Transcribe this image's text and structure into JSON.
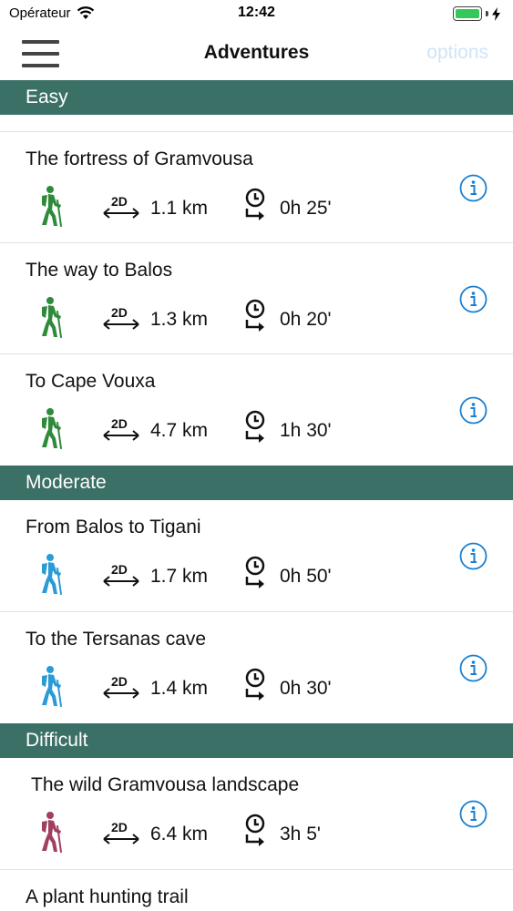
{
  "status": {
    "carrier": "Opérateur",
    "time": "12:42"
  },
  "nav": {
    "title": "Adventures",
    "options_label": "options"
  },
  "sections": [
    {
      "title": "Easy",
      "color": "#2e8b3a",
      "items": [
        {
          "title": "The fortress of Gramvousa",
          "distance": "1.1 km",
          "duration": "0h 25'"
        },
        {
          "title": "The way to Balos",
          "distance": "1.3 km",
          "duration": "0h 20'"
        },
        {
          "title": "To Cape Vouxa",
          "distance": "4.7 km",
          "duration": "1h 30'"
        }
      ]
    },
    {
      "title": "Moderate",
      "color": "#2a9bd6",
      "items": [
        {
          "title": "From Balos to Tigani",
          "distance": "1.7 km",
          "duration": "0h 50'"
        },
        {
          "title": "To the Tersanas cave",
          "distance": "1.4 km",
          "duration": "0h 30'"
        }
      ]
    },
    {
      "title": "Difficult",
      "color": "#a0405e",
      "items": [
        {
          "title": "The wild Gramvousa landscape",
          "distance": "6.4 km",
          "duration": "3h 5'"
        },
        {
          "title": "A plant hunting trail"
        }
      ]
    }
  ],
  "distance_icon_label": "2D",
  "icons": {
    "menu": "hamburger-menu-icon",
    "info": "info-circle-icon",
    "distance": "distance-2d-icon",
    "duration": "clock-arrow-icon",
    "hiker": "hiker-icon"
  },
  "colors": {
    "section_header": "#3a7066",
    "info_blue": "#1a7fd0",
    "options_disabled": "#cfe4f6"
  }
}
